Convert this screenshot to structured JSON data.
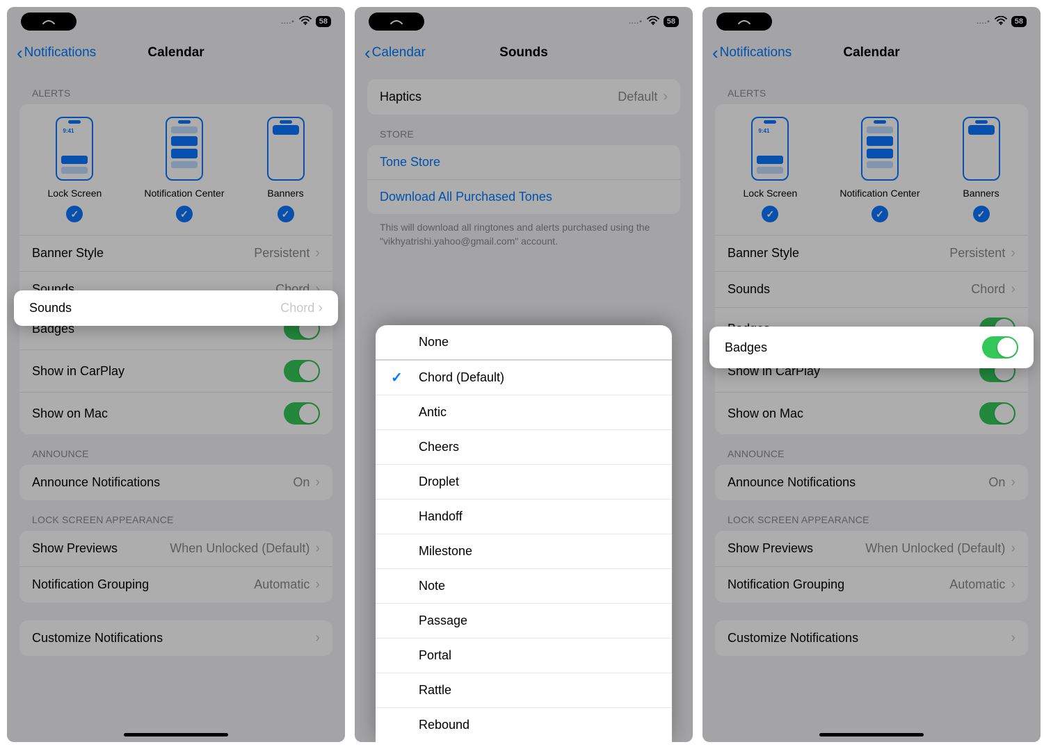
{
  "status": {
    "battery": "58",
    "signal_dots": "....▪"
  },
  "screen1": {
    "back": "Notifications",
    "title": "Calendar",
    "sections": {
      "alerts_header": "ALERTS",
      "lock_screen": "Lock Screen",
      "lock_time": "9:41",
      "notification_center": "Notification Center",
      "banners": "Banners",
      "banner_style_label": "Banner Style",
      "banner_style_value": "Persistent",
      "sounds_label": "Sounds",
      "sounds_value": "Chord",
      "badges_label": "Badges",
      "badges_on": true,
      "carplay_label": "Show in CarPlay",
      "carplay_on": true,
      "mac_label": "Show on Mac",
      "mac_on": true,
      "announce_header": "ANNOUNCE",
      "announce_label": "Announce Notifications",
      "announce_value": "On",
      "lockappearance_header": "LOCK SCREEN APPEARANCE",
      "previews_label": "Show Previews",
      "previews_value": "When Unlocked (Default)",
      "grouping_label": "Notification Grouping",
      "grouping_value": "Automatic",
      "customize_label": "Customize Notifications"
    }
  },
  "screen2": {
    "back": "Calendar",
    "title": "Sounds",
    "haptics_label": "Haptics",
    "haptics_value": "Default",
    "store_header": "STORE",
    "tone_store": "Tone Store",
    "download_all": "Download All Purchased Tones",
    "download_note": "This will download all ringtones and alerts purchased using the \"vikhyatrishi.yahoo@gmail.com\" account.",
    "sounds": [
      {
        "name": "None",
        "selected": false
      },
      {
        "name": "Chord (Default)",
        "selected": true
      },
      {
        "name": "Antic",
        "selected": false
      },
      {
        "name": "Cheers",
        "selected": false
      },
      {
        "name": "Droplet",
        "selected": false
      },
      {
        "name": "Handoff",
        "selected": false
      },
      {
        "name": "Milestone",
        "selected": false
      },
      {
        "name": "Note",
        "selected": false
      },
      {
        "name": "Passage",
        "selected": false
      },
      {
        "name": "Portal",
        "selected": false
      },
      {
        "name": "Rattle",
        "selected": false
      },
      {
        "name": "Rebound",
        "selected": false
      }
    ]
  },
  "screen3": {
    "back": "Notifications",
    "title": "Calendar",
    "highlight_label": "Badges"
  }
}
